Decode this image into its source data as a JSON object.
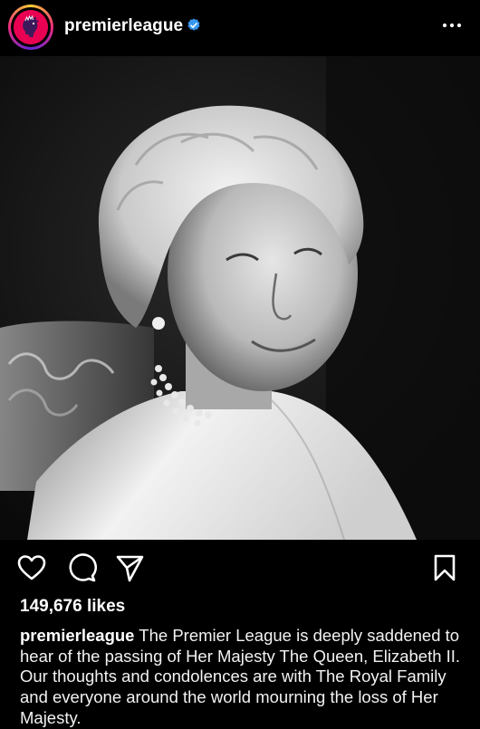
{
  "header": {
    "username": "premierleague",
    "verified_icon": "verified-badge-icon",
    "more_icon": "more-options-icon",
    "accent_color": "#3897f0",
    "avatar_color": "#e90052"
  },
  "post": {
    "image_icon": "photo",
    "likes": "149,676 likes",
    "caption_user": "premierleague",
    "caption_text": "The Premier League is deeply saddened to hear of the passing of Her Majesty The Queen, Elizabeth II. Our thoughts and condolences are with The Royal Family and everyone around the world mourning the loss of Her Majesty."
  },
  "actions": {
    "like_icon": "heart-icon",
    "comment_icon": "comment-icon",
    "share_icon": "send-icon",
    "save_icon": "bookmark-icon"
  }
}
